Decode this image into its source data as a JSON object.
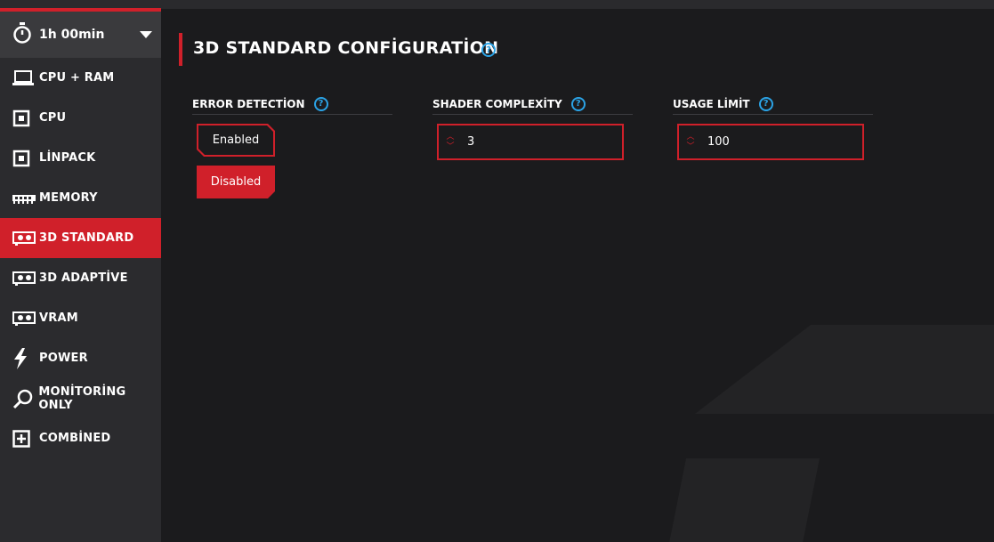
{
  "timer": {
    "label": "1h 00min"
  },
  "sidebar": {
    "items": [
      {
        "label": "CPU + RAM",
        "icon": "laptop-icon",
        "active": false
      },
      {
        "label": "CPU",
        "icon": "chip-icon",
        "active": false
      },
      {
        "label": "LİNPACK",
        "icon": "chip-icon",
        "active": false
      },
      {
        "label": "MEMORY",
        "icon": "memory-icon",
        "active": false
      },
      {
        "label": "3D STANDARD",
        "icon": "gpu-icon",
        "active": true
      },
      {
        "label": "3D ADAPTİVE",
        "icon": "gpu-icon",
        "active": false
      },
      {
        "label": "VRAM",
        "icon": "gpu-icon",
        "active": false
      },
      {
        "label": "POWER",
        "icon": "lightning-icon",
        "active": false
      },
      {
        "label": "MONİTORİNG ONLY",
        "icon": "magnifier-icon",
        "active": false
      },
      {
        "label": "COMBİNED",
        "icon": "plus-box-icon",
        "active": false
      }
    ]
  },
  "main": {
    "title": "3D STANDARD CONFİGURATİON",
    "help_glyph": "?",
    "error_detection": {
      "label": "ERROR DETECTİON",
      "options": [
        "Enabled",
        "Disabled"
      ],
      "selected": "Disabled"
    },
    "shader_complexity": {
      "label": "SHADER COMPLEXİTY",
      "value": "3"
    },
    "usage_limit": {
      "label": "USAGE LİMİT",
      "value": "100"
    }
  },
  "colors": {
    "accent": "#d0202a",
    "help": "#2ba3e6",
    "sidebar": "#2b2b2e",
    "background": "#1b1b1d"
  }
}
